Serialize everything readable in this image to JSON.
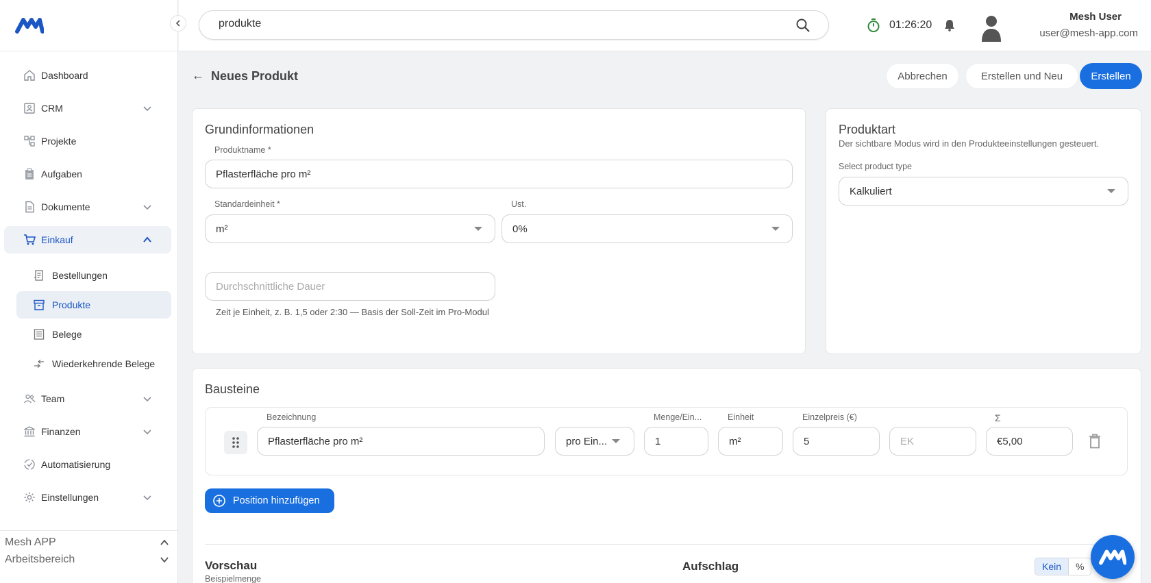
{
  "sidebar": {
    "items": [
      {
        "label": "Dashboard",
        "icon": "home-icon"
      },
      {
        "label": "CRM",
        "icon": "contact-card-icon"
      },
      {
        "label": "Projekte",
        "icon": "project-tree-icon"
      },
      {
        "label": "Aufgaben",
        "icon": "clipboard-icon"
      },
      {
        "label": "Dokumente",
        "icon": "document-icon"
      },
      {
        "label": "Einkauf",
        "icon": "cart-icon"
      },
      {
        "label": "Team",
        "icon": "team-icon"
      },
      {
        "label": "Finanzen",
        "icon": "bank-icon"
      },
      {
        "label": "Automatisierung",
        "icon": "automation-icon"
      },
      {
        "label": "Einstellungen",
        "icon": "gear-icon"
      }
    ],
    "sub_items": [
      {
        "label": "Bestellungen",
        "icon": "receipt-icon"
      },
      {
        "label": "Produkte",
        "icon": "archive-box-icon"
      },
      {
        "label": "Belege",
        "icon": "list-doc-icon"
      },
      {
        "label": "Wiederkehrende Belege",
        "icon": "recurring-icon"
      }
    ],
    "footer": {
      "app": "Mesh APP",
      "workspace": "Arbeitsbereich"
    }
  },
  "topbar": {
    "search_value": "produkte",
    "timer": "01:26:20",
    "user_name": "Mesh User",
    "user_email": "user@mesh-app.com"
  },
  "page": {
    "back_arrow": "←",
    "title": "Neues Produkt",
    "cancel_label": "Abbrechen",
    "create_new_label": "Erstellen und Neu",
    "create_label": "Erstellen"
  },
  "grundinfo": {
    "title": "Grundinformationen",
    "name_label": "Produktname *",
    "name_value": "Pflasterfläche pro m²",
    "unit_label": "Standardeinheit *",
    "unit_value": "m²",
    "vat_label": "Ust.",
    "vat_value": "0%",
    "duration_placeholder": "Durchschnittliche Dauer",
    "duration_hint": "Zeit je Einheit, z. B. 1,5 oder 2:30 — Basis der Soll-Zeit im Pro-Modul"
  },
  "produktart": {
    "title": "Produktart",
    "description": "Der sichtbare Modus wird in den Produkteeinstellungen gesteuert.",
    "select_label": "Select product type",
    "select_value": "Kalkuliert"
  },
  "bausteine": {
    "title": "Bausteine",
    "col_bezeichnung": "Bezeichnung",
    "col_menge": "Menge/Ein...",
    "col_einheit": "Einheit",
    "col_einzelpreis": "Einzelpreis (€)",
    "col_sum": "Σ",
    "row": {
      "bezeichnung": "Pflasterfläche pro m²",
      "mode": "pro Ein...",
      "menge": "1",
      "einheit": "m²",
      "einzelpreis": "5",
      "ek_placeholder": "EK",
      "sum": "€5,00"
    },
    "add_label": "Position hinzufügen"
  },
  "preview": {
    "title": "Vorschau",
    "subtitle": "Beispielmenge",
    "aufschlag": "Aufschlag",
    "toggle_off": "Kein",
    "toggle_pct": "%"
  },
  "colors": {
    "accent": "#1a6fe0",
    "timer": "#2e8b3b"
  }
}
